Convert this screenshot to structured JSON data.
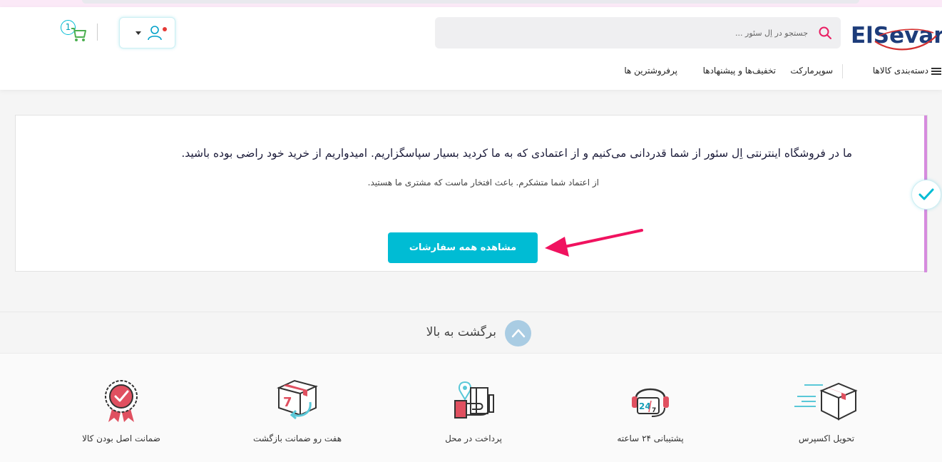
{
  "brand": {
    "logo_text": "ElSevar"
  },
  "search": {
    "placeholder": "جستجو در اِل سئور ..."
  },
  "cart": {
    "count": "1"
  },
  "nav": {
    "categories": "دسته‌بندی کالاها",
    "items": [
      "سوپرمارکت",
      "تخفیف‌ها و پیشنهادها",
      "پرفروشترین ها"
    ]
  },
  "confirmation": {
    "message": "ما در فروشگاه اینترنتی اِل سئور از شما قدردانی می‌کنیم و از اعتمادی که به ما کردید بسیار سپاسگزاریم. امیدواریم از خرید خود راضی بوده باشید.",
    "submessage": "از اعتماد شما متشکرم. باعث افتخار ماست که مشتری ما هستید.",
    "button_label": "مشاهده همه سفارشات"
  },
  "back_to_top": {
    "label": "برگشت به بالا"
  },
  "features": [
    {
      "label": "تحویل اکسپرس",
      "icon": "express-delivery-icon"
    },
    {
      "label": "پشتیبانی ۲۴ ساعته",
      "icon": "support-24-7-icon"
    },
    {
      "label": "پرداخت در محل",
      "icon": "cash-on-delivery-icon"
    },
    {
      "label": "هفت رو ضمانت بازگشت",
      "icon": "seven-day-return-icon"
    },
    {
      "label": "ضمانت اصل بودن کالا",
      "icon": "original-guarantee-icon"
    }
  ],
  "colors": {
    "accent": "#00bcd4",
    "brand_blue": "#1d3c7a",
    "brand_red": "#d32f2f",
    "highlight_arrow": "#f0125f",
    "side_line": "#d68bde"
  }
}
